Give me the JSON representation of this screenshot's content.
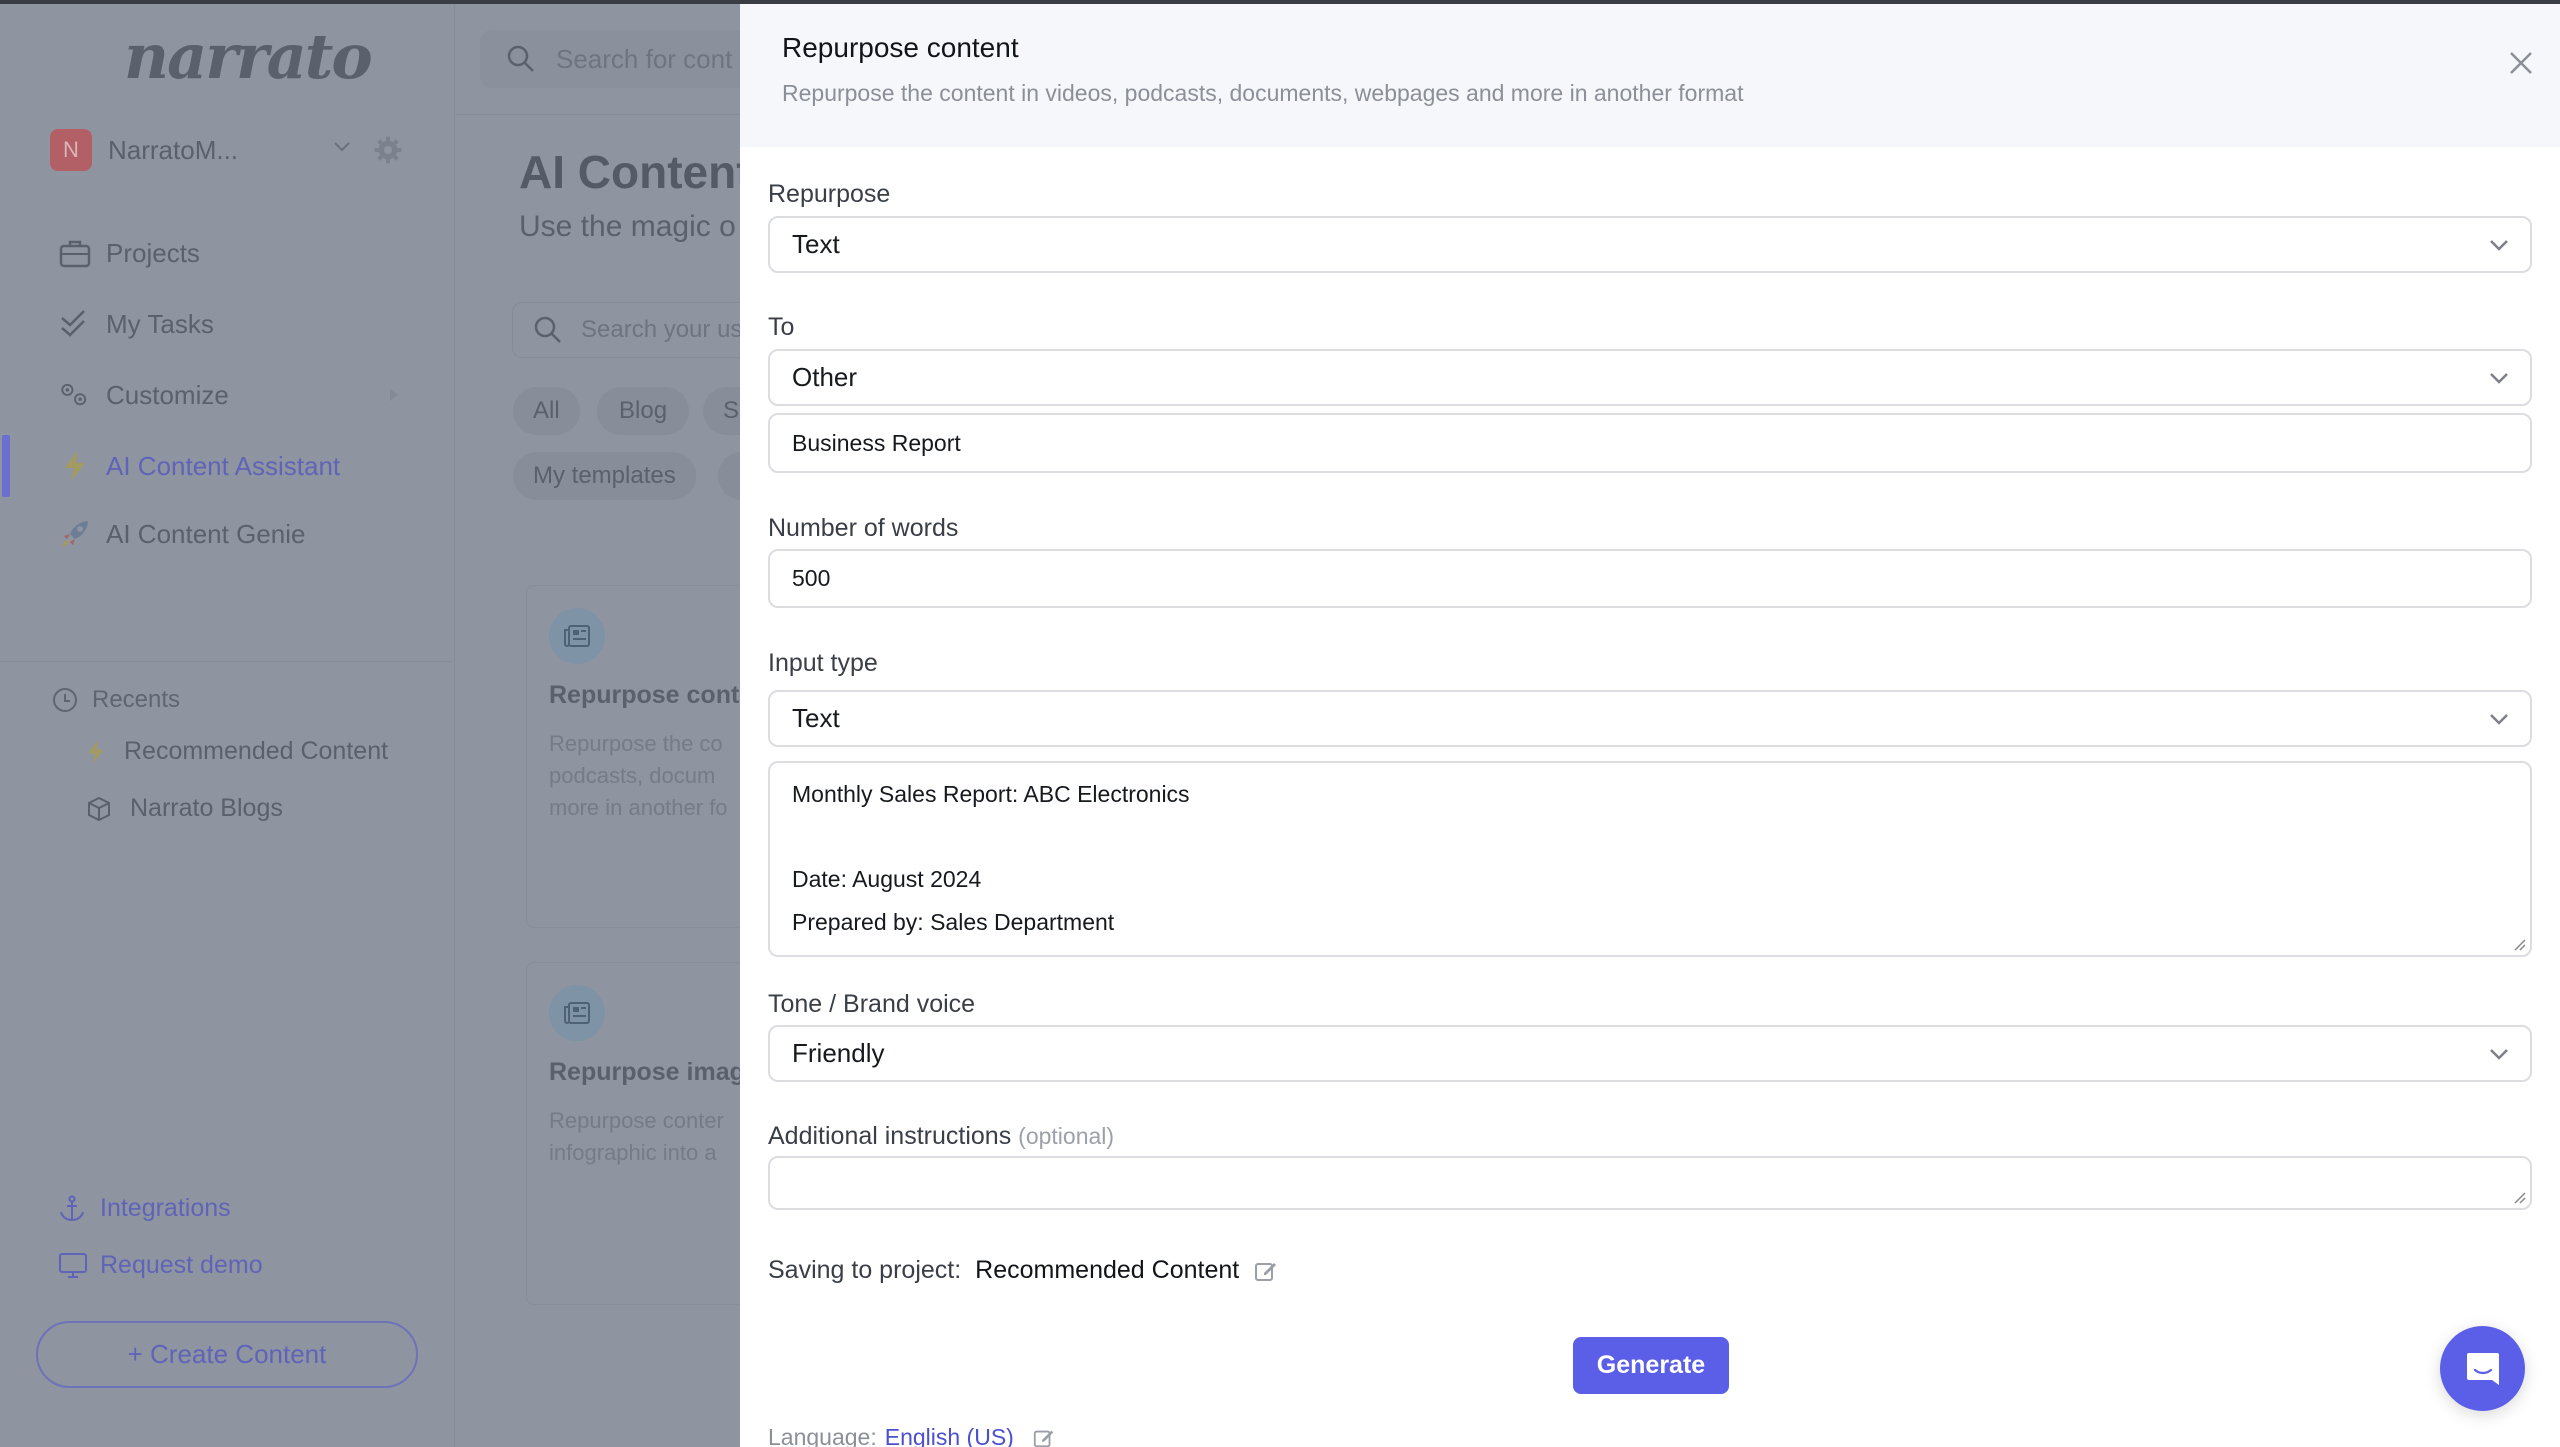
{
  "sidebar": {
    "logo": "narrato",
    "workspace": {
      "initial": "N",
      "name": "NarratoM..."
    },
    "nav": [
      {
        "label": "Projects",
        "icon": "briefcase-icon"
      },
      {
        "label": "My Tasks",
        "icon": "double-check-icon"
      },
      {
        "label": "Customize",
        "icon": "gears-icon"
      },
      {
        "label": "AI Content Assistant",
        "icon": "lightning-icon",
        "active": true
      },
      {
        "label": "AI Content Genie",
        "icon": "rocket-icon"
      }
    ],
    "recents": {
      "label": "Recents",
      "items": [
        {
          "label": "Recommended Content",
          "icon": "lightning-icon"
        },
        {
          "label": "Narrato Blogs",
          "icon": "cube-icon"
        }
      ]
    },
    "bottom_links": [
      {
        "label": "Integrations",
        "icon": "anchor-icon"
      },
      {
        "label": "Request demo",
        "icon": "monitor-icon"
      }
    ],
    "create_button": "+ Create Content"
  },
  "background": {
    "top_search_placeholder": "Search for cont",
    "title": "AI Content",
    "subtitle": "Use the magic o",
    "template_search_placeholder": "Search your us",
    "chips": [
      "All",
      "Blog",
      "S",
      "My templates"
    ],
    "cards": [
      {
        "title": "Repurpose cont",
        "desc": [
          "Repurpose the co",
          "podcasts, docum",
          "more in another fo"
        ]
      },
      {
        "title": "Repurpose imag",
        "desc": [
          "Repurpose conter",
          "infographic into a"
        ]
      }
    ]
  },
  "drawer": {
    "title": "Repurpose content",
    "subtitle": "Repurpose the content in videos, podcasts, documents, webpages and more in another format",
    "fields": {
      "repurpose": {
        "label": "Repurpose",
        "value": "Text"
      },
      "to": {
        "label": "To",
        "value": "Other",
        "custom_value": "Business Report"
      },
      "words": {
        "label": "Number of words",
        "value": "500"
      },
      "input_type": {
        "label": "Input type",
        "value": "Text"
      },
      "input_text": {
        "lines": [
          "Monthly Sales Report: ABC Electronics",
          "",
          "Date: August 2024",
          "Prepared by: Sales Department"
        ]
      },
      "tone": {
        "label": "Tone / Brand voice",
        "value": "Friendly"
      },
      "instructions": {
        "label": "Additional instructions",
        "optional": "(optional)",
        "value": ""
      }
    },
    "saving": {
      "label": "Saving to project:",
      "project": "Recommended Content"
    },
    "generate_label": "Generate",
    "language": {
      "label": "Language:",
      "value": "English (US)"
    }
  },
  "colors": {
    "accent": "#5b5fe8",
    "overlay": "#8e94a0",
    "header_bg": "#f6f7fa"
  }
}
